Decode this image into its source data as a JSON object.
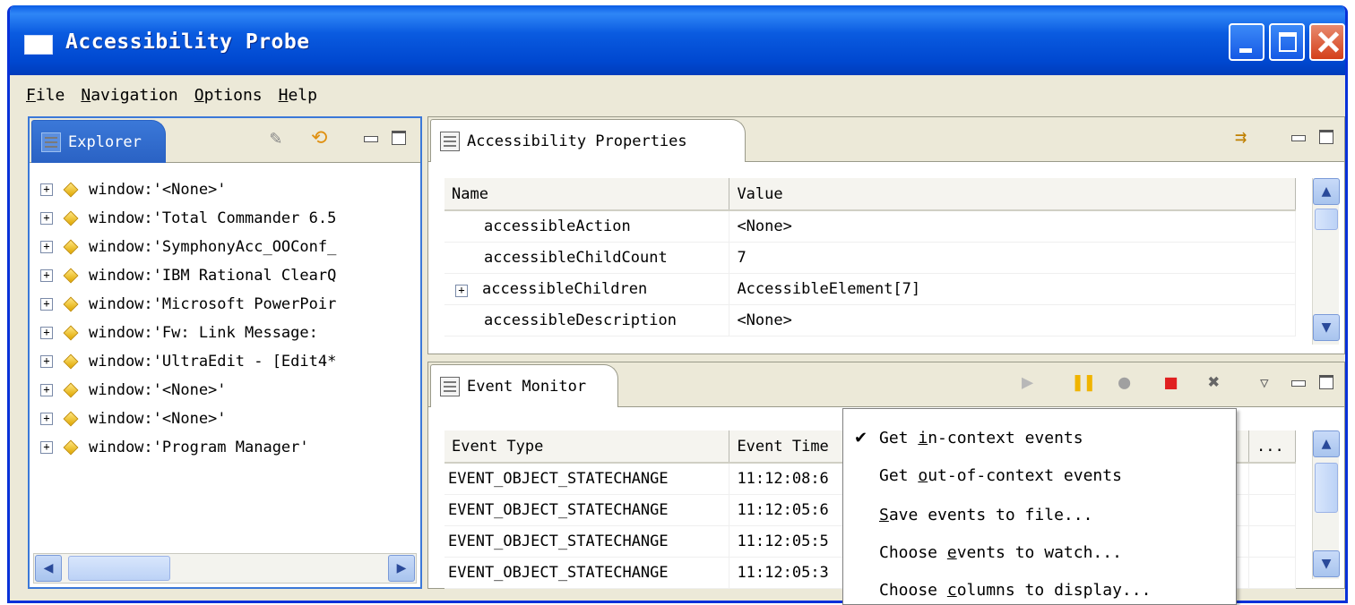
{
  "window": {
    "title": "Accessibility Probe"
  },
  "menubar": [
    {
      "label": "File",
      "mnemonic": "F",
      "rest": "ile"
    },
    {
      "label": "Navigation",
      "mnemonic": "N",
      "rest": "avigation"
    },
    {
      "label": "Options",
      "mnemonic": "O",
      "rest": "ptions"
    },
    {
      "label": "Help",
      "mnemonic": "H",
      "rest": "elp"
    }
  ],
  "explorer": {
    "tab_label": "Explorer",
    "items": [
      "window:'<None>'",
      "window:'Total Commander 6.5",
      "window:'SymphonyAcc_OOConf_",
      "window:'IBM Rational ClearQ",
      "window:'Microsoft PowerPoir",
      "window:'Fw: Link Message:",
      "window:'UltraEdit - [Edit4*",
      "window:'<None>'",
      "window:'<None>'",
      "window:'Program Manager'"
    ]
  },
  "properties": {
    "tab_label": "Accessibility Properties",
    "columns": [
      "Name",
      "Value"
    ],
    "rows": [
      {
        "name": "accessibleAction",
        "value": "<None>",
        "expandable": false
      },
      {
        "name": "accessibleChildCount",
        "value": "7",
        "expandable": false
      },
      {
        "name": "accessibleChildren",
        "value": "AccessibleElement[7]",
        "expandable": true
      },
      {
        "name": "accessibleDescription",
        "value": "<None>",
        "expandable": false
      }
    ]
  },
  "event_monitor": {
    "tab_label": "Event Monitor",
    "columns": [
      "Event Type",
      "Event Time",
      "..."
    ],
    "rows": [
      {
        "type": "EVENT_OBJECT_STATECHANGE",
        "time": "11:12:08:6"
      },
      {
        "type": "EVENT_OBJECT_STATECHANGE",
        "time": "11:12:05:6"
      },
      {
        "type": "EVENT_OBJECT_STATECHANGE",
        "time": "11:12:05:5"
      },
      {
        "type": "EVENT_OBJECT_STATECHANGE",
        "time": "11:12:05:3"
      }
    ]
  },
  "context_menu": {
    "items": [
      {
        "before": "Get ",
        "mnemonic": "i",
        "after": "n-context events",
        "checked": true
      },
      {
        "before": "Get ",
        "mnemonic": "o",
        "after": "ut-of-context events",
        "checked": false
      },
      {
        "before": "",
        "mnemonic": "S",
        "after": "ave events to file...",
        "checked": false
      },
      {
        "before": "Choose ",
        "mnemonic": "e",
        "after": "vents to watch...",
        "checked": false
      },
      {
        "before": "Choose ",
        "mnemonic": "c",
        "after": "olumns to display...",
        "checked": false
      }
    ],
    "check_glyph": "✔"
  },
  "colors": {
    "title_blue": "#0a5ce6",
    "active_tab": "#3b78d8",
    "stop_red": "#e02020",
    "play_gold": "#f0b400"
  }
}
